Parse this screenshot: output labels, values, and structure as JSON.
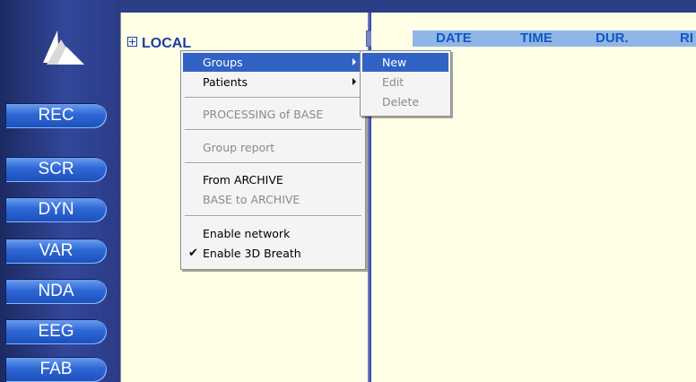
{
  "sidebar": {
    "buttons": [
      "REC",
      "SCR",
      "DYN",
      "VAR",
      "NDA",
      "EEG",
      "FAB"
    ]
  },
  "tree": {
    "root_label": "LOCAL"
  },
  "table": {
    "columns": [
      "DATE",
      "TIME",
      "DUR.",
      "RI"
    ]
  },
  "context_menu": {
    "groups": "Groups",
    "patients": "Patients",
    "processing": "PROCESSING of BASE",
    "group_report": "Group report",
    "from_archive": "From ARCHIVE",
    "base_to_archive": "BASE to ARCHIVE",
    "enable_network": "Enable network",
    "enable_3d_breath": "Enable 3D Breath"
  },
  "submenu": {
    "new": "New",
    "edit": "Edit",
    "delete": "Delete"
  },
  "colors": {
    "highlight": "#3163c5",
    "nav_button": "#2f68d6",
    "panel_bg": "#ffffe8",
    "header_text": "#1357c4"
  }
}
